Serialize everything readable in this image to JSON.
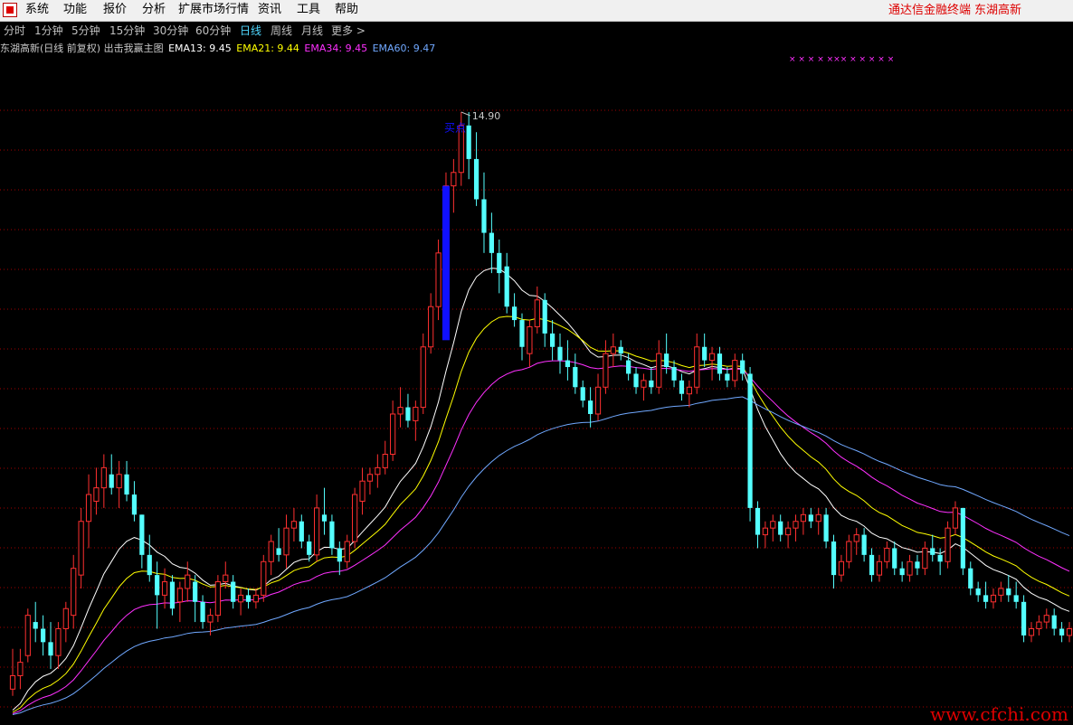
{
  "menu": {
    "items": [
      "系统",
      "功能",
      "报价",
      "分析",
      "扩展市场行情",
      "资讯",
      "工具",
      "帮助"
    ],
    "right_app_name": "通达信金融终端",
    "right_stock_name": "东湖高新"
  },
  "periods": {
    "items": [
      "分时",
      "1分钟",
      "5分钟",
      "15分钟",
      "30分钟",
      "60分钟",
      "日线",
      "周线",
      "月线",
      "更多 >"
    ],
    "active": "日线"
  },
  "indicator_line": {
    "title": "东湖高新(日线 前复权) 出击我赢主图",
    "ema13": "EMA13: 9.45",
    "ema21": "EMA21: 9.44",
    "ema34": "EMA34: 9.45",
    "ema60": "EMA60: 9.47"
  },
  "colors": {
    "up": "#ff3030",
    "down": "#54ffff",
    "ema13": "#ffffff",
    "ema21": "#ffff00",
    "ema34": "#ff30ff",
    "ema60": "#70a8ff",
    "grid": "#a00000",
    "signal_bar": "#1010ff",
    "marker": "#ff30ff"
  },
  "annotation": {
    "signal_label": "买点",
    "peak_price": "14.90"
  },
  "watermark": "www.cfchi.com",
  "chart_data": {
    "type": "candlestick",
    "price_range": [
      5.9,
      15.6
    ],
    "candles": [
      [
        6.3,
        6.9,
        6.2,
        6.5
      ],
      [
        6.5,
        6.9,
        6.3,
        6.7
      ],
      [
        6.8,
        7.5,
        6.7,
        7.4
      ],
      [
        7.3,
        7.6,
        7.0,
        7.2
      ],
      [
        7.2,
        7.4,
        6.8,
        7.0
      ],
      [
        7.0,
        7.3,
        6.6,
        6.8
      ],
      [
        6.8,
        7.3,
        6.6,
        7.2
      ],
      [
        7.2,
        7.6,
        7.0,
        7.5
      ],
      [
        7.4,
        8.3,
        7.2,
        8.1
      ],
      [
        8.0,
        9.0,
        7.8,
        8.8
      ],
      [
        8.8,
        9.5,
        8.4,
        9.2
      ],
      [
        9.1,
        9.6,
        8.9,
        9.3
      ],
      [
        9.3,
        9.8,
        9.0,
        9.6
      ],
      [
        9.5,
        9.8,
        9.2,
        9.3
      ],
      [
        9.3,
        9.7,
        9.0,
        9.5
      ],
      [
        9.5,
        9.7,
        9.1,
        9.2
      ],
      [
        9.2,
        9.4,
        8.8,
        8.9
      ],
      [
        8.9,
        8.9,
        8.1,
        8.3
      ],
      [
        8.3,
        8.6,
        7.9,
        8.0
      ],
      [
        8.0,
        8.2,
        7.2,
        7.7
      ],
      [
        7.7,
        8.1,
        7.5,
        7.9
      ],
      [
        7.9,
        8.0,
        7.4,
        7.5
      ],
      [
        7.6,
        7.9,
        7.3,
        7.8
      ],
      [
        7.8,
        8.2,
        7.6,
        8.0
      ],
      [
        7.9,
        8.0,
        7.3,
        7.6
      ],
      [
        7.6,
        7.7,
        7.2,
        7.3
      ],
      [
        7.3,
        7.5,
        7.1,
        7.4
      ],
      [
        7.4,
        8.0,
        7.3,
        7.9
      ],
      [
        7.9,
        8.2,
        7.8,
        8.0
      ],
      [
        7.9,
        8.0,
        7.5,
        7.6
      ],
      [
        7.6,
        7.8,
        7.4,
        7.7
      ],
      [
        7.7,
        7.8,
        7.5,
        7.6
      ],
      [
        7.6,
        7.8,
        7.5,
        7.7
      ],
      [
        7.7,
        8.3,
        7.6,
        8.2
      ],
      [
        8.2,
        8.6,
        8.0,
        8.5
      ],
      [
        8.4,
        8.7,
        8.2,
        8.3
      ],
      [
        8.3,
        8.9,
        8.1,
        8.7
      ],
      [
        8.7,
        9.0,
        8.5,
        8.8
      ],
      [
        8.8,
        8.9,
        8.4,
        8.5
      ],
      [
        8.5,
        8.6,
        8.2,
        8.3
      ],
      [
        8.3,
        9.2,
        8.2,
        9.0
      ],
      [
        8.9,
        9.3,
        8.6,
        8.8
      ],
      [
        8.8,
        8.9,
        8.3,
        8.4
      ],
      [
        8.4,
        8.5,
        8.0,
        8.2
      ],
      [
        8.2,
        8.6,
        8.1,
        8.5
      ],
      [
        8.5,
        9.3,
        8.4,
        9.2
      ],
      [
        9.1,
        9.6,
        8.9,
        9.4
      ],
      [
        9.4,
        9.6,
        9.2,
        9.5
      ],
      [
        9.5,
        9.8,
        9.3,
        9.6
      ],
      [
        9.6,
        10.0,
        9.5,
        9.8
      ],
      [
        9.8,
        10.6,
        9.7,
        10.4
      ],
      [
        10.4,
        10.8,
        10.2,
        10.5
      ],
      [
        10.5,
        10.7,
        10.2,
        10.3
      ],
      [
        10.3,
        10.6,
        10.0,
        10.5
      ],
      [
        10.5,
        11.6,
        10.4,
        11.4
      ],
      [
        11.4,
        12.2,
        11.3,
        12.0
      ],
      [
        12.0,
        13.0,
        11.8,
        12.8
      ],
      [
        12.8,
        14.0,
        12.7,
        13.8
      ],
      [
        13.8,
        14.2,
        13.4,
        14.0
      ],
      [
        14.0,
        14.9,
        13.8,
        14.7
      ],
      [
        14.7,
        14.9,
        13.9,
        14.2
      ],
      [
        14.2,
        14.6,
        13.5,
        13.6
      ],
      [
        13.6,
        14.0,
        12.8,
        13.1
      ],
      [
        13.1,
        13.4,
        12.5,
        12.8
      ],
      [
        12.8,
        13.0,
        12.2,
        12.5
      ],
      [
        12.6,
        12.8,
        11.9,
        12.0
      ],
      [
        12.0,
        12.2,
        11.7,
        11.8
      ],
      [
        11.8,
        11.9,
        11.2,
        11.4
      ],
      [
        11.3,
        11.8,
        11.1,
        11.7
      ],
      [
        11.7,
        12.3,
        11.6,
        12.1
      ],
      [
        12.1,
        12.2,
        11.4,
        11.6
      ],
      [
        11.6,
        11.8,
        11.2,
        11.4
      ],
      [
        11.4,
        11.6,
        11.0,
        11.2
      ],
      [
        11.2,
        11.5,
        10.9,
        11.1
      ],
      [
        11.1,
        11.3,
        10.7,
        10.8
      ],
      [
        10.8,
        10.9,
        10.5,
        10.6
      ],
      [
        10.6,
        10.8,
        10.2,
        10.4
      ],
      [
        10.4,
        11.0,
        10.3,
        10.8
      ],
      [
        10.8,
        11.5,
        10.7,
        11.3
      ],
      [
        11.3,
        11.6,
        11.1,
        11.4
      ],
      [
        11.4,
        11.5,
        11.2,
        11.3
      ],
      [
        11.2,
        11.3,
        10.9,
        11.0
      ],
      [
        11.0,
        11.1,
        10.7,
        10.8
      ],
      [
        10.8,
        11.0,
        10.6,
        10.9
      ],
      [
        10.9,
        11.1,
        10.7,
        10.8
      ],
      [
        10.8,
        11.5,
        10.7,
        11.3
      ],
      [
        11.3,
        11.6,
        11.0,
        11.1
      ],
      [
        11.1,
        11.2,
        10.8,
        10.9
      ],
      [
        10.9,
        11.0,
        10.6,
        10.7
      ],
      [
        10.7,
        10.9,
        10.5,
        10.8
      ],
      [
        10.8,
        11.6,
        10.7,
        11.4
      ],
      [
        11.4,
        11.6,
        11.1,
        11.2
      ],
      [
        11.2,
        11.4,
        10.9,
        11.3
      ],
      [
        11.3,
        11.4,
        10.9,
        11.0
      ],
      [
        11.0,
        11.1,
        10.8,
        10.9
      ],
      [
        10.9,
        11.3,
        10.8,
        11.2
      ],
      [
        11.2,
        11.3,
        10.9,
        11.0
      ],
      [
        11.0,
        11.1,
        8.8,
        9.0
      ],
      [
        9.0,
        9.1,
        8.4,
        8.6
      ],
      [
        8.6,
        8.8,
        8.4,
        8.7
      ],
      [
        8.7,
        8.9,
        8.5,
        8.8
      ],
      [
        8.8,
        8.9,
        8.5,
        8.6
      ],
      [
        8.6,
        8.8,
        8.4,
        8.7
      ],
      [
        8.7,
        8.9,
        8.5,
        8.8
      ],
      [
        8.8,
        9.0,
        8.6,
        8.9
      ],
      [
        8.9,
        9.0,
        8.7,
        8.8
      ],
      [
        8.8,
        9.0,
        8.6,
        8.9
      ],
      [
        8.9,
        9.0,
        8.4,
        8.5
      ],
      [
        8.5,
        8.6,
        7.8,
        8.0
      ],
      [
        8.0,
        8.3,
        7.9,
        8.2
      ],
      [
        8.2,
        8.6,
        8.1,
        8.5
      ],
      [
        8.5,
        8.7,
        8.3,
        8.6
      ],
      [
        8.6,
        8.7,
        8.2,
        8.3
      ],
      [
        8.3,
        8.4,
        7.9,
        8.0
      ],
      [
        8.0,
        8.3,
        7.9,
        8.2
      ],
      [
        8.2,
        8.5,
        8.1,
        8.4
      ],
      [
        8.4,
        8.5,
        8.0,
        8.1
      ],
      [
        8.1,
        8.2,
        7.9,
        8.0
      ],
      [
        8.0,
        8.3,
        7.9,
        8.2
      ],
      [
        8.2,
        8.3,
        8.0,
        8.1
      ],
      [
        8.1,
        8.5,
        8.0,
        8.4
      ],
      [
        8.4,
        8.6,
        8.2,
        8.3
      ],
      [
        8.3,
        8.4,
        8.0,
        8.2
      ],
      [
        8.2,
        8.8,
        8.1,
        8.7
      ],
      [
        8.7,
        9.1,
        8.6,
        9.0
      ],
      [
        9.0,
        9.0,
        8.0,
        8.1
      ],
      [
        8.1,
        8.2,
        7.7,
        7.8
      ],
      [
        7.8,
        7.9,
        7.6,
        7.7
      ],
      [
        7.7,
        7.9,
        7.5,
        7.6
      ],
      [
        7.6,
        7.8,
        7.5,
        7.7
      ],
      [
        7.7,
        7.9,
        7.6,
        7.8
      ],
      [
        7.8,
        8.0,
        7.6,
        7.7
      ],
      [
        7.7,
        7.9,
        7.5,
        7.6
      ],
      [
        7.6,
        7.7,
        7.0,
        7.1
      ],
      [
        7.1,
        7.3,
        7.0,
        7.2
      ],
      [
        7.2,
        7.4,
        7.1,
        7.3
      ],
      [
        7.3,
        7.5,
        7.2,
        7.4
      ],
      [
        7.4,
        7.5,
        7.1,
        7.2
      ],
      [
        7.2,
        7.3,
        7.0,
        7.1
      ],
      [
        7.1,
        7.3,
        7.0,
        7.2
      ]
    ],
    "signal_bar": {
      "candle_index": 57,
      "low": 11.5,
      "high": 13.8
    },
    "markers": "× × × × ××× × × × × ×"
  }
}
